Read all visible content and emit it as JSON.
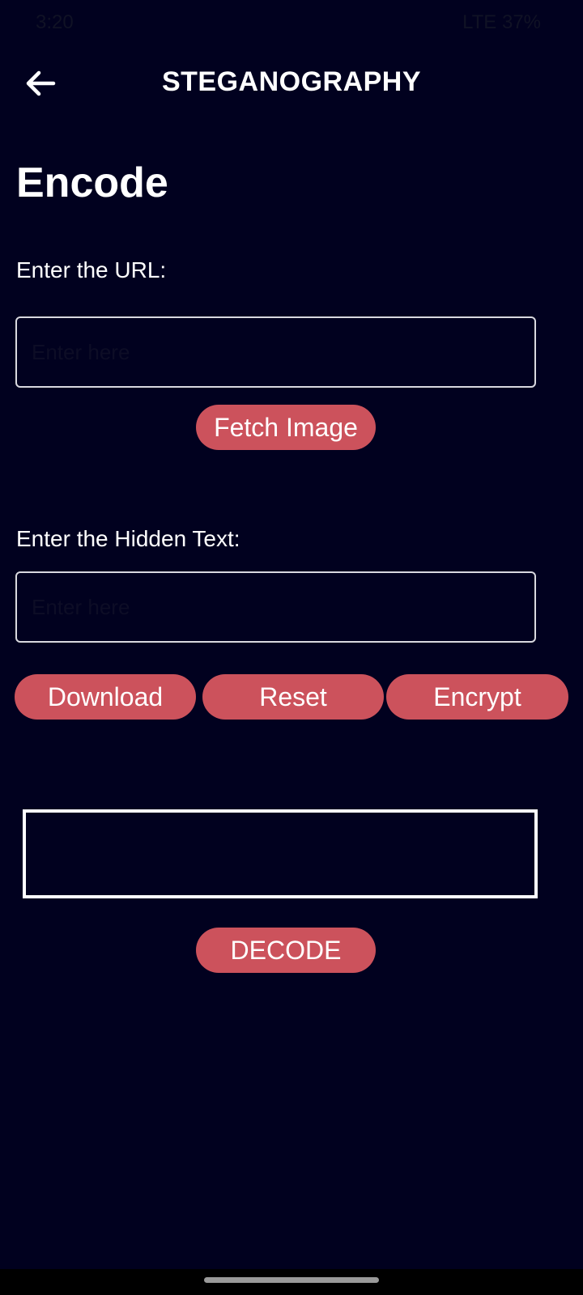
{
  "status_bar": {
    "time": "3:20",
    "right": "LTE 37%"
  },
  "app_bar": {
    "title": "STEGANOGRAPHY",
    "back_icon": "arrow-left-icon"
  },
  "page": {
    "title": "Encode"
  },
  "url_section": {
    "label": "Enter the URL:",
    "placeholder": "Enter here",
    "value": "",
    "button_label": "Fetch Image"
  },
  "hidden_text_section": {
    "label": "Enter the Hidden Text:",
    "placeholder": "Enter here",
    "value": ""
  },
  "actions": {
    "download_label": "Download",
    "reset_label": "Reset",
    "encrypt_label": "Encrypt"
  },
  "output": {
    "text": ""
  },
  "decode": {
    "label": "DECODE"
  },
  "colors": {
    "background": "#01011f",
    "button": "#cc525c",
    "text": "#ffffff",
    "field_border": "#d9d9df"
  }
}
